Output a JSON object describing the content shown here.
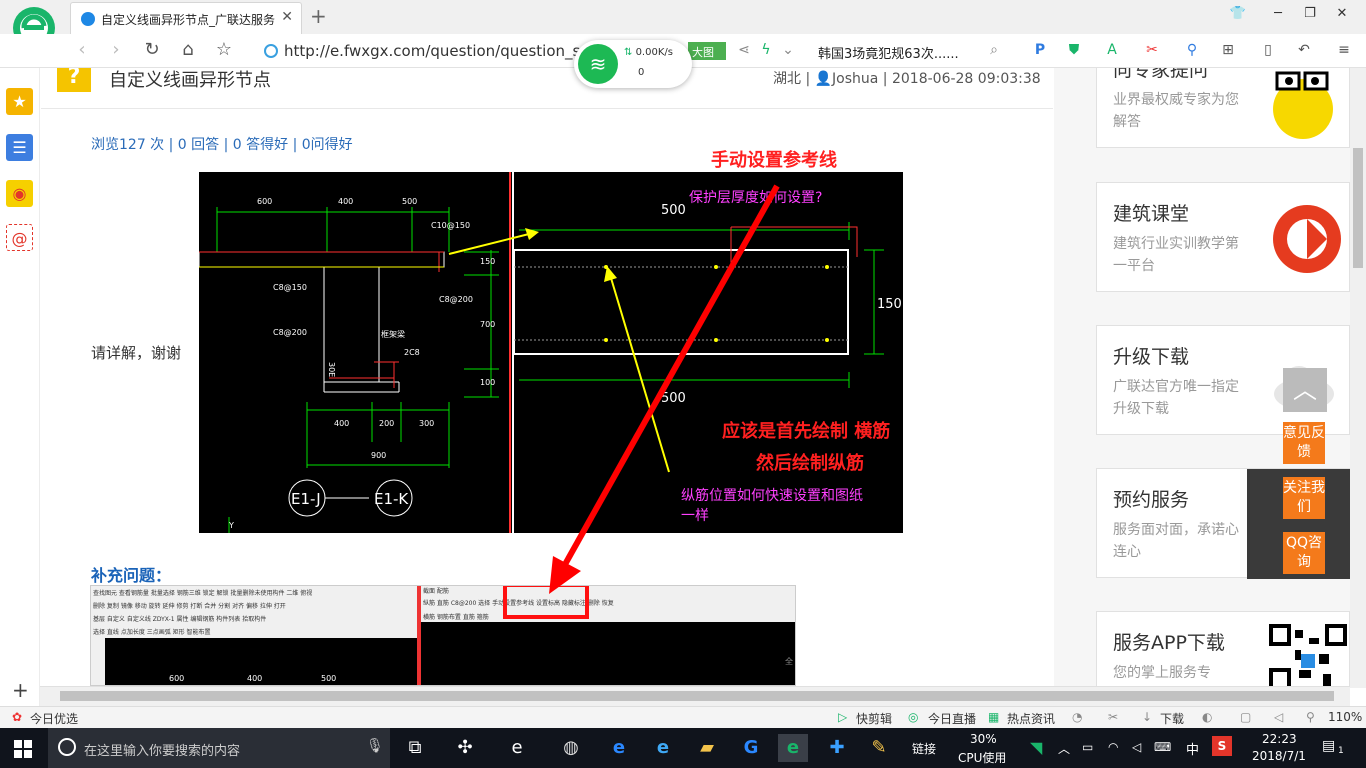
{
  "browser": {
    "tab_title": "自定义线画异形节点_广联达服务",
    "tab_close": "✕",
    "new_tab": "+",
    "url": "http://e.fwxgx.com/question/question_s",
    "news": "韩国3场竟犯规63次......",
    "nav": {
      "back": "‹",
      "forward": "›",
      "reload": "↻",
      "home": "⌂",
      "star": "☆"
    },
    "window": {
      "min": "─",
      "max": "❐",
      "close": "✕",
      "skin": "👕"
    }
  },
  "net_widget": {
    "speed": "0.00K/s",
    "count": "0",
    "badge": "大图"
  },
  "question": {
    "title": "自定义线画异形节点",
    "meta": "湖北 | 👤Joshua | 2018-06-28 09:03:38",
    "stats": "浏览127 次 | 0 回答 | 0 答得好 | 0问得好",
    "body": "请详解，谢谢",
    "supplement": "补充问题："
  },
  "cad": {
    "annotations": {
      "manual_ref": "手动设置参考线",
      "cover": "保护层厚度如何设置?",
      "order1": "应该是首先绘制 横筋",
      "order2": "然后绘制纵筋",
      "longbar1": "纵筋位置如何快速设置和图纸",
      "longbar2": "一样"
    },
    "left_dims": {
      "d600": "600",
      "d400": "400",
      "d500": "500",
      "c10": "C10@150",
      "c8a": "C8@150",
      "c8b": "C8@200",
      "c8c": "C8@200",
      "beam": "框架梁",
      "c2": "2C8",
      "v150": "150",
      "v700": "700",
      "v100": "100",
      "b400": "400",
      "b200": "200",
      "b300": "300",
      "b900": "900",
      "e1j": "E1-J",
      "e1k": "E1-K",
      "v30": "30E",
      "y": "Y"
    },
    "right_dims": {
      "top": "500",
      "side": "150",
      "bottom": "500"
    }
  },
  "cad2": {
    "toolbar_text": "查找图元  查看钢筋量  批量选择  钢筋三维  锁定  解锁  批量删除未使用构件  二维  俯视",
    "row2": "删除  复制  镜像  移动  旋转  延伸  修剪  打断  合并  分割  对齐  偏移  拉伸  打开",
    "row3": "基层  自定义  自定义线  ZDYX-1  属性  编辑钢筋  构件列表  拾取构件",
    "row4": "选择  直线  点加长度  三点画弧  矩形  智能布置",
    "tabs": "截面  配筋",
    "right_row1": "纵筋  直筋  C8@200  选择  手动设置参考线  设置标高  隐藏标注  删除  恢复",
    "right_row2": "横筋  钢筋布置 直筋  箍筋",
    "dim600": "600",
    "dim400": "400",
    "dim500": "500",
    "dim_partial": "全"
  },
  "sidebar_right": {
    "cards": [
      {
        "title": "向专家提问",
        "sub": "业界最权威专家为您解答"
      },
      {
        "title": "建筑课堂",
        "sub": "建筑行业实训教学第一平台"
      },
      {
        "title": "升级下载",
        "sub": "广联达官方唯一指定升级下载"
      },
      {
        "title": "预约服务",
        "sub": "服务面对面，承诺心连心"
      },
      {
        "title": "服务APP下载",
        "sub": "您的掌上服务专"
      }
    ],
    "floating": {
      "feedback": "意见反馈",
      "follow": "关注我们",
      "qq": "QQ咨询",
      "totop": "︿"
    }
  },
  "statusbar": {
    "left": "今日优选",
    "kuaijianji": "快剪辑",
    "live": "今日直播",
    "news": "热点资讯",
    "download": "下载",
    "zoom": "110%"
  },
  "taskbar": {
    "search_placeholder": "在这里输入你要搜索的内容",
    "link": "链接",
    "cpu_pct": "30%",
    "cpu_label": "CPU使用",
    "ime": "中",
    "time": "22:23",
    "date": "2018/7/1",
    "notif": "1"
  }
}
